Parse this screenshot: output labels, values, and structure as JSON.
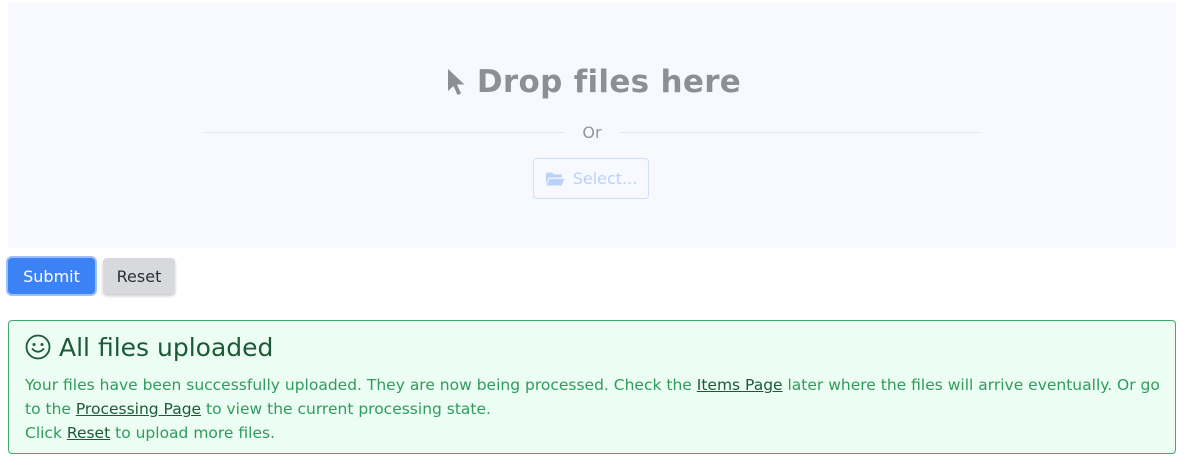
{
  "dropzone": {
    "title": "Drop files here",
    "divider_text": "Or",
    "select_label": "Select...",
    "icons": {
      "cursor": "cursor-icon",
      "folder": "folder-open-icon"
    }
  },
  "actions": {
    "submit_label": "Submit",
    "reset_label": "Reset"
  },
  "success": {
    "icon": "smile-icon",
    "title": "All files uploaded",
    "line1_prefix": "Your files have been successfully uploaded. They are now being processed. Check the ",
    "items_link": "Items Page",
    "line1_middle": " later where the files will arrive eventually. Or go to the ",
    "processing_link": "Processing Page",
    "line1_suffix": " to view the current processing state.",
    "line2_prefix": "Click ",
    "reset_link": "Reset",
    "line2_suffix": " to upload more files."
  },
  "colors": {
    "primary": "#3b82f6",
    "success_bg": "#ecfdf3",
    "success_border": "#40a86c",
    "success_text": "#2f9c5c",
    "muted": "#8c9096"
  }
}
